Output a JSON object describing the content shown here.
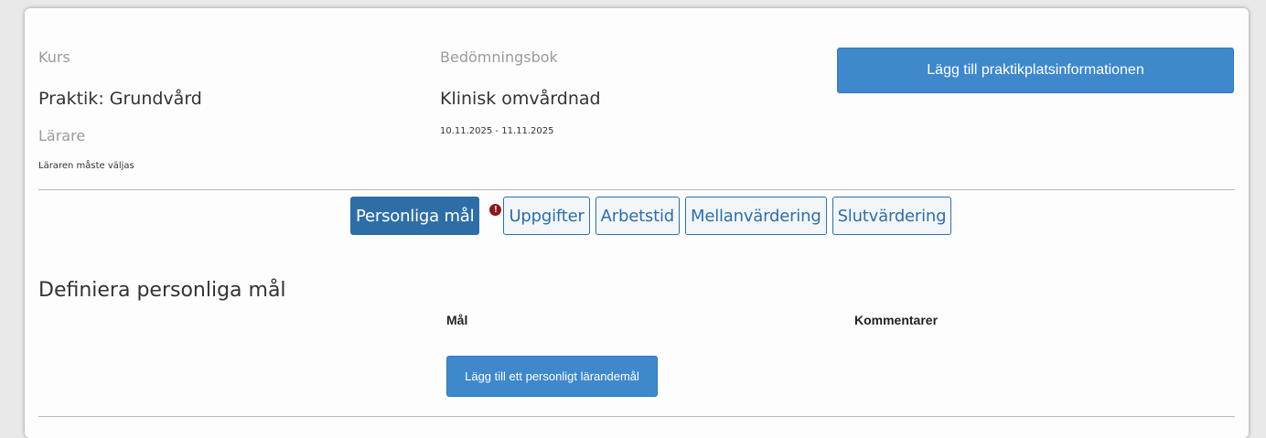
{
  "header": {
    "course_label": "Kurs",
    "course_value": "Praktik: Grundvård",
    "teacher_label": "Lärare",
    "teacher_note": "Läraren måste väljas",
    "gradebook_label": "Bedömningsbok",
    "gradebook_value": "Klinisk omvårdnad",
    "date_range": "10.11.2025 - 11.11.2025",
    "add_info_button": "Lägg till praktikplatsinformationen"
  },
  "tabs": [
    {
      "label": "Personliga mål",
      "active": true,
      "warning": true
    },
    {
      "label": "Uppgifter",
      "active": false
    },
    {
      "label": "Arbetstid",
      "active": false
    },
    {
      "label": "Mellanvärdering",
      "active": false
    },
    {
      "label": "Slutvärdering",
      "active": false
    }
  ],
  "warning_icon_glyph": "!",
  "goals": {
    "title": "Definiera personliga mål",
    "col_goal": "Mål",
    "col_comments": "Kommentarer",
    "add_goal_button": "Lägg till ett personligt lärandemål"
  },
  "colors": {
    "primary_button": "#3e88cb",
    "active_tab": "#2e6ea6",
    "warning": "#8b1a1a"
  }
}
